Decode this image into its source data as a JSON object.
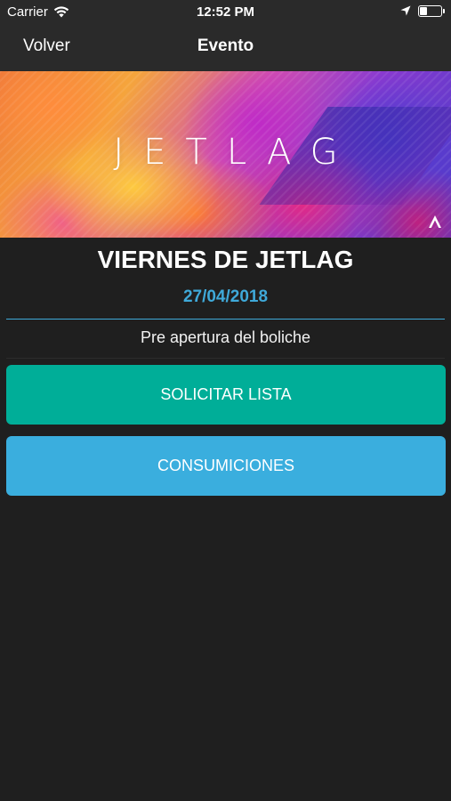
{
  "status_bar": {
    "carrier": "Carrier",
    "time": "12:52 PM",
    "battery_level": 0.35
  },
  "nav": {
    "back_label": "Volver",
    "title": "Evento"
  },
  "banner": {
    "text": "JETLAG",
    "logo_icon": "jetlag-logo-icon"
  },
  "event": {
    "title": "VIERNES DE JETLAG",
    "date": "27/04/2018",
    "description": "Pre apertura del boliche"
  },
  "actions": {
    "request_list_label": "SOLICITAR LISTA",
    "consumptions_label": "CONSUMICIONES"
  },
  "colors": {
    "accent_blue": "#3fa9d9",
    "teal_button": "#00ae98",
    "blue_button": "#3aaede",
    "background": "#1f1f1f"
  }
}
